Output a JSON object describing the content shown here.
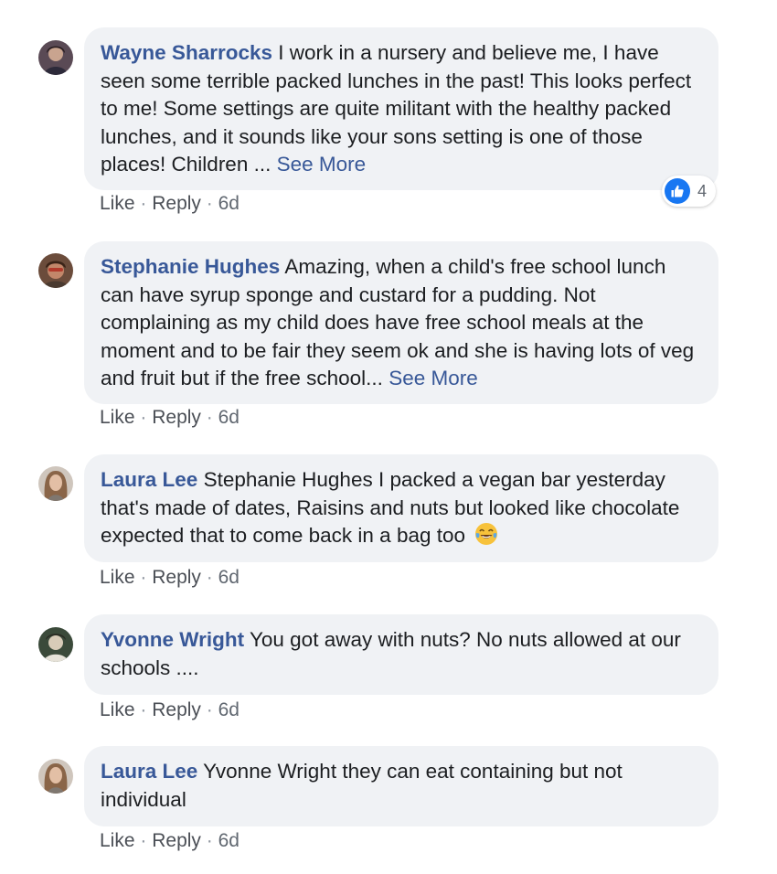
{
  "comments": [
    {
      "author": "Wayne Sharrocks",
      "text": "I work in a nursery and believe me, I have seen some terrible packed lunches in the past! This looks perfect to me! Some settings are quite militant with the healthy packed lunches, and it sounds like your sons setting is one of those places! Children ...",
      "see_more": "See More",
      "like": "Like",
      "reply": "Reply",
      "time": "6d",
      "reaction_icon": "like-icon",
      "reaction_count": "4"
    },
    {
      "author": "Stephanie Hughes",
      "text": "Amazing, when a child's free school lunch can have syrup sponge and custard for a pudding. Not complaining as my child does have free school meals at the moment and to be fair they seem ok and she is having lots of veg and fruit but if the free school...",
      "see_more": "See More",
      "like": "Like",
      "reply": "Reply",
      "time": "6d"
    },
    {
      "author": "Laura Lee",
      "text": "Stephanie Hughes I packed a vegan bar yesterday that's made of dates, Raisins and nuts but looked like chocolate expected that to come back in a bag too",
      "emoji": "tears-of-joy-emoji",
      "like": "Like",
      "reply": "Reply",
      "time": "6d"
    },
    {
      "author": "Yvonne Wright",
      "text": "You got away with nuts? No nuts allowed at our schools ....",
      "like": "Like",
      "reply": "Reply",
      "time": "6d"
    },
    {
      "author": "Laura Lee",
      "text": "Yvonne Wright they can eat containing but not individual",
      "like": "Like",
      "reply": "Reply",
      "time": "6d"
    }
  ],
  "separator": "·",
  "colors": {
    "author_link": "#385898",
    "bubble_bg": "#f0f2f5",
    "action_text": "#606770",
    "like_blue": "#1877f2"
  }
}
